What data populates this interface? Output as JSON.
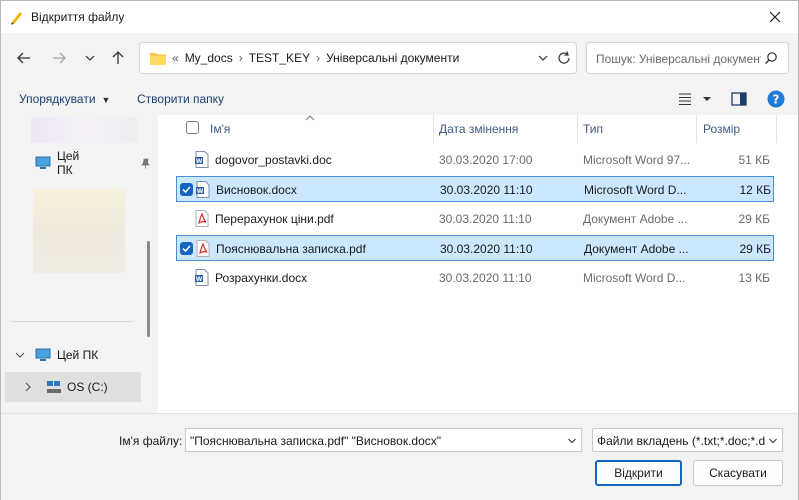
{
  "window": {
    "title": "Відкриття файлу"
  },
  "nav": {
    "breadcrumb_lead": "«",
    "breadcrumbs": [
      "My_docs",
      "TEST_KEY",
      "Універсальні документи"
    ],
    "search_placeholder": "Пошук: Універсальні документи"
  },
  "toolbar": {
    "organize_label": "Упорядкувати",
    "new_folder_label": "Створити папку"
  },
  "sidebar": {
    "items": [
      {
        "label": "Цей ПК"
      },
      {
        "label": "Цей ПК"
      },
      {
        "label": "OS (C:)"
      }
    ]
  },
  "columns": {
    "name": "Ім'я",
    "date": "Дата змінення",
    "type": "Тип",
    "size": "Розмір"
  },
  "files": [
    {
      "name": "dogovor_postavki.doc",
      "date": "30.03.2020 17:00",
      "type": "Microsoft Word 97...",
      "size": "51 КБ",
      "icon": "word-doc-icon",
      "selected": false
    },
    {
      "name": "Висновок.docx",
      "date": "30.03.2020 11:10",
      "type": "Microsoft Word D...",
      "size": "12 КБ",
      "icon": "word-doc-icon",
      "selected": true
    },
    {
      "name": "Перерахунок ціни.pdf",
      "date": "30.03.2020 11:10",
      "type": "Документ Adobe ...",
      "size": "29 КБ",
      "icon": "pdf-icon",
      "selected": false
    },
    {
      "name": "Пояснювальна записка.pdf",
      "date": "30.03.2020 11:10",
      "type": "Документ Adobe ...",
      "size": "29 КБ",
      "icon": "pdf-icon",
      "selected": true
    },
    {
      "name": "Розрахунки.docx",
      "date": "30.03.2020 11:10",
      "type": "Microsoft Word D...",
      "size": "13 КБ",
      "icon": "word-doc-icon",
      "selected": false
    }
  ],
  "footer": {
    "filename_label": "Ім'я файлу:",
    "filename_value": "\"Пояснювальна записка.pdf\" \"Висновок.docx\"",
    "filter_value": "Файли вкладень (*.txt;*.doc;*.d",
    "open_label": "Відкрити",
    "cancel_label": "Скасувати"
  },
  "colors": {
    "accent": "#1565c0",
    "selection_bg": "#cce8ff",
    "selection_border": "#4a8fd4"
  }
}
